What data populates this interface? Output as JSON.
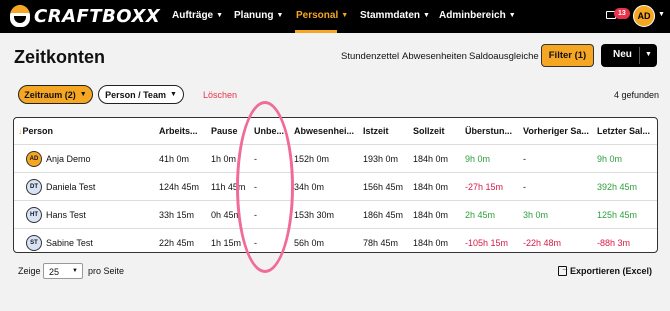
{
  "header": {
    "logo_text": "CRAFTBOXX",
    "nav": [
      {
        "label": "Aufträge"
      },
      {
        "label": "Planung"
      },
      {
        "label": "Personal",
        "active": true
      },
      {
        "label": "Stammdaten"
      },
      {
        "label": "Adminbereich"
      }
    ],
    "notification_count": "13",
    "user_initials": "AD"
  },
  "page": {
    "title": "Zeitkonten",
    "links": {
      "stundenzettel": "Stundenzettel",
      "abwesenheiten": "Abwesenheiten",
      "saldoausgleiche": "Saldoausgleiche"
    },
    "filter_button": "Filter (1)",
    "new_button": "Neu"
  },
  "filters": {
    "zeitraum": "Zeitraum (2)",
    "person_team": "Person / Team",
    "delete": "Löschen",
    "found": "4 gefunden"
  },
  "table": {
    "columns": [
      "Person",
      "Arbeits...",
      "Pause",
      "Unbe...",
      "Abwesenhei...",
      "Istzeit",
      "Sollzeit",
      "Überstun...",
      "Vorheriger Sa...",
      "Letzter Sal..."
    ],
    "rows": [
      {
        "initials": "AD",
        "avatar": "orange",
        "name": "Anja Demo",
        "arbeit": "41h 0m",
        "pause": "1h 0m",
        "unbe": "-",
        "abw": "152h 0m",
        "ist": "193h 0m",
        "soll": "184h 0m",
        "ueber": "9h 0m",
        "ueber_c": "pos",
        "vor": "-",
        "vor_c": "",
        "letzt": "9h 0m",
        "letzt_c": "pos"
      },
      {
        "initials": "DT",
        "avatar": "blue",
        "name": "Daniela Test",
        "arbeit": "124h 45m",
        "pause": "11h 45m",
        "unbe": "-",
        "abw": "34h 0m",
        "ist": "156h 45m",
        "soll": "184h 0m",
        "ueber": "-27h 15m",
        "ueber_c": "neg",
        "vor": "-",
        "vor_c": "",
        "letzt": "392h 45m",
        "letzt_c": "pos"
      },
      {
        "initials": "HT",
        "avatar": "blue",
        "name": "Hans Test",
        "arbeit": "33h 15m",
        "pause": "0h 45m",
        "unbe": "-",
        "abw": "153h 30m",
        "ist": "186h 45m",
        "soll": "184h 0m",
        "ueber": "2h 45m",
        "ueber_c": "pos",
        "vor": "3h 0m",
        "vor_c": "pos",
        "letzt": "125h 45m",
        "letzt_c": "pos"
      },
      {
        "initials": "ST",
        "avatar": "blue",
        "name": "Sabine Test",
        "arbeit": "22h 45m",
        "pause": "1h 15m",
        "unbe": "-",
        "abw": "56h 0m",
        "ist": "78h 45m",
        "soll": "184h 0m",
        "ueber": "-105h 15m",
        "ueber_c": "neg",
        "vor": "-22h 48m",
        "vor_c": "neg",
        "letzt": "-88h 3m",
        "letzt_c": "neg"
      }
    ]
  },
  "footer": {
    "show_label": "Zeige",
    "page_size": "25",
    "per_page_label": "pro Seite",
    "export_label": "Exportieren (Excel)"
  },
  "colors": {
    "accent": "#f5a623",
    "positive": "#2e9e3c",
    "negative": "#d81b45",
    "annotation": "#f06a9a"
  }
}
